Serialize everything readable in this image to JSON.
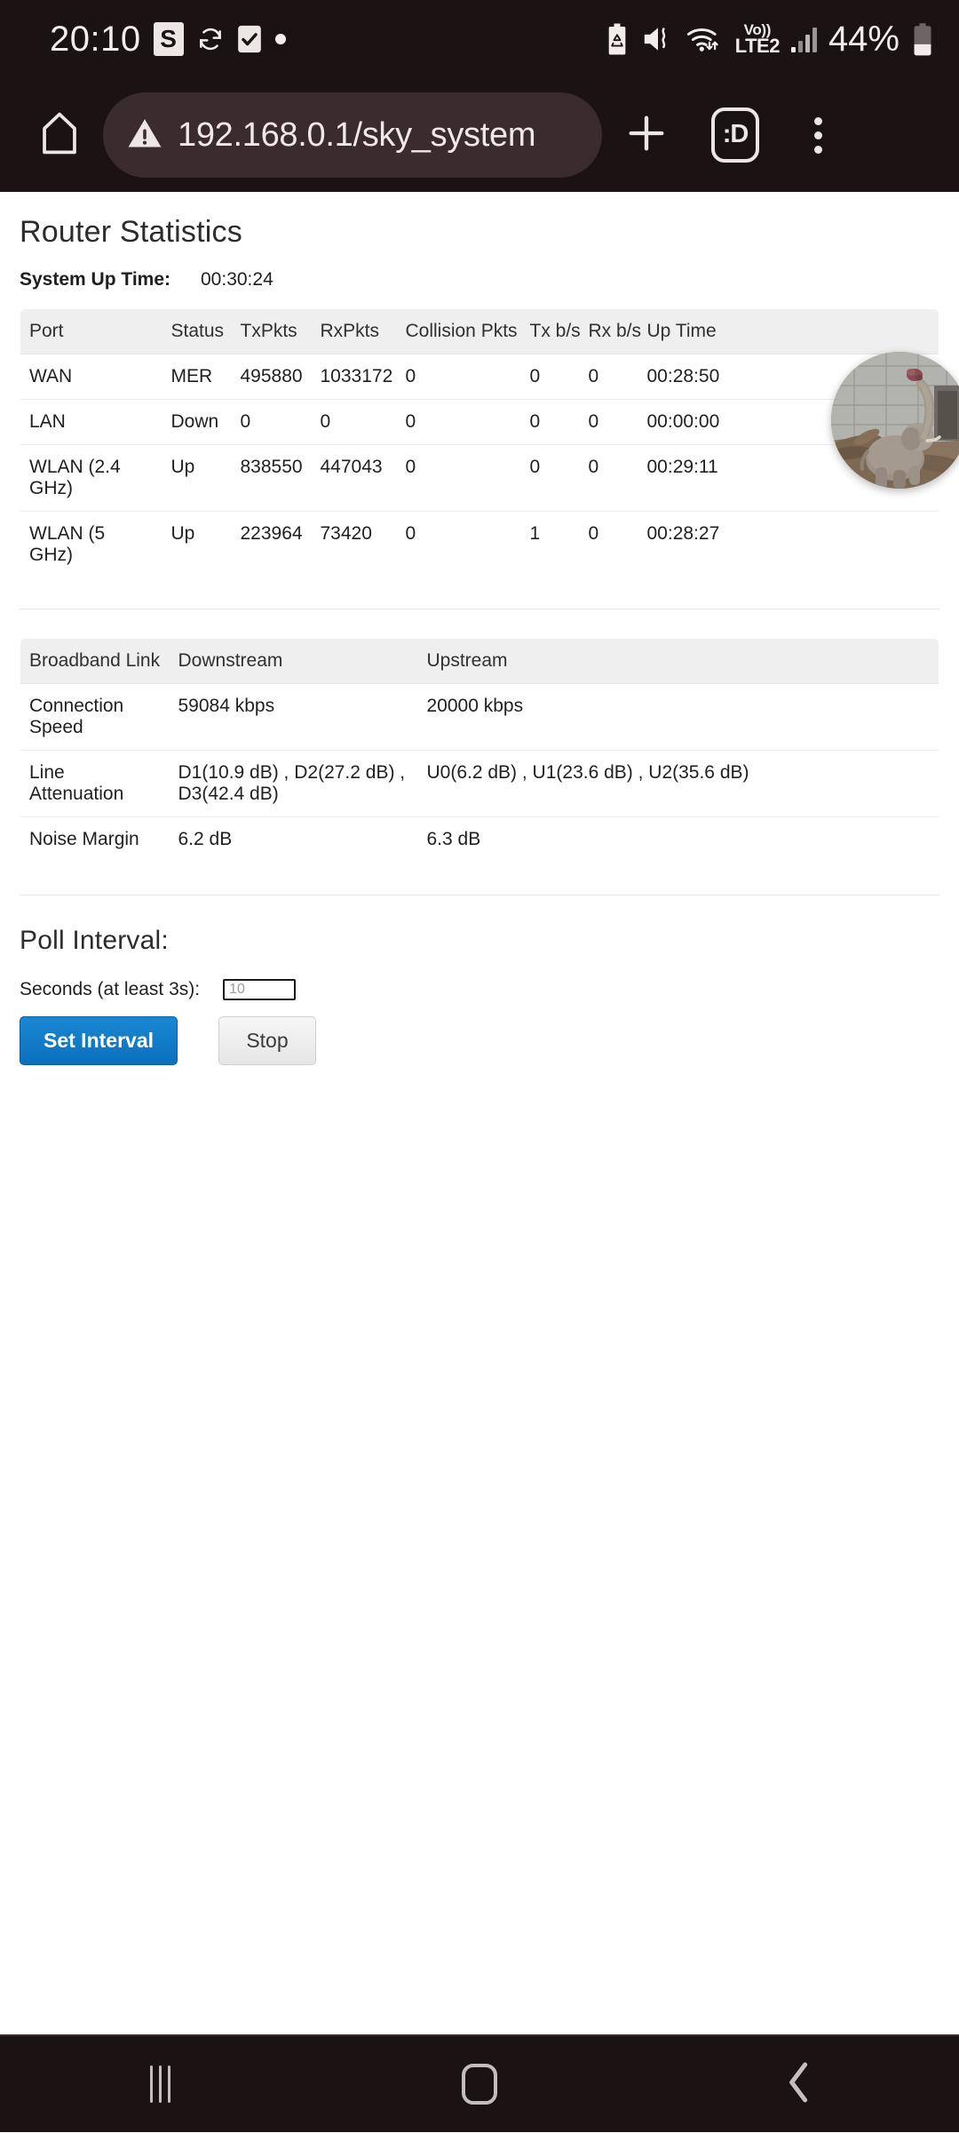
{
  "status_bar": {
    "clock": "20:10",
    "badge_letter": "S",
    "icons": [
      "sync-icon",
      "checkbox-checked-icon",
      "dot-indicator-icon",
      "battery-recycle-icon",
      "mute-vibrate-icon",
      "wifi-transfer-icon"
    ],
    "network_top": "Vo))",
    "network_bottom": "LTE2",
    "battery_percent": "44%"
  },
  "browser": {
    "url": "192.168.0.1/sky_system",
    "security_icon": "warning-triangle-icon",
    "home_icon": "home-icon",
    "new_tab_icon": "plus-icon",
    "tab_count": ":D",
    "menu_icon": "more-vertical-icon"
  },
  "page": {
    "title": "Router Statistics",
    "uptime_label": "System Up Time:",
    "uptime_value": "00:30:24",
    "port_table": {
      "headers": [
        "Port",
        "Status",
        "TxPkts",
        "RxPkts",
        "Collision Pkts",
        "Tx b/s",
        "Rx b/s",
        "Up Time"
      ],
      "rows": [
        [
          "WAN",
          "MER",
          "495880",
          "1033172",
          "0",
          "0",
          "0",
          "00:28:50"
        ],
        [
          "LAN",
          "Down",
          "0",
          "0",
          "0",
          "0",
          "0",
          "00:00:00"
        ],
        [
          "WLAN (2.4 GHz)",
          "Up",
          "838550",
          "447043",
          "0",
          "0",
          "0",
          "00:29:11"
        ],
        [
          "WLAN (5 GHz)",
          "Up",
          "223964",
          "73420",
          "0",
          "1",
          "0",
          "00:28:27"
        ]
      ]
    },
    "broadband_table": {
      "headers": [
        "Broadband Link",
        "Downstream",
        "Upstream"
      ],
      "rows": [
        [
          "Connection Speed",
          "59084 kbps",
          "20000 kbps"
        ],
        [
          "Line Attenuation",
          "D1(10.9 dB) , D2(27.2 dB) , D3(42.4 dB)",
          "U0(6.2 dB) , U1(23.6 dB) , U2(35.6 dB)"
        ],
        [
          "Noise Margin",
          "6.2 dB",
          "6.3 dB"
        ]
      ]
    },
    "poll": {
      "title": "Poll Interval:",
      "seconds_label": "Seconds (at least 3s):",
      "input_placeholder": "10",
      "input_value": "",
      "set_button": "Set Interval",
      "stop_button": "Stop"
    }
  },
  "pip": {
    "name": "picture-in-picture-video-bubble",
    "subject": "elephant in enclosure"
  },
  "nav_bar": {
    "recents": "recents-icon",
    "home": "home-square-icon",
    "back": "back-chevron-icon"
  },
  "colors": {
    "chrome_bg": "#1b1214",
    "url_pill": "#3a2b2f",
    "accent_button": "#0b70bd",
    "table_header": "#efefef",
    "page_bg": "#ffffff"
  }
}
